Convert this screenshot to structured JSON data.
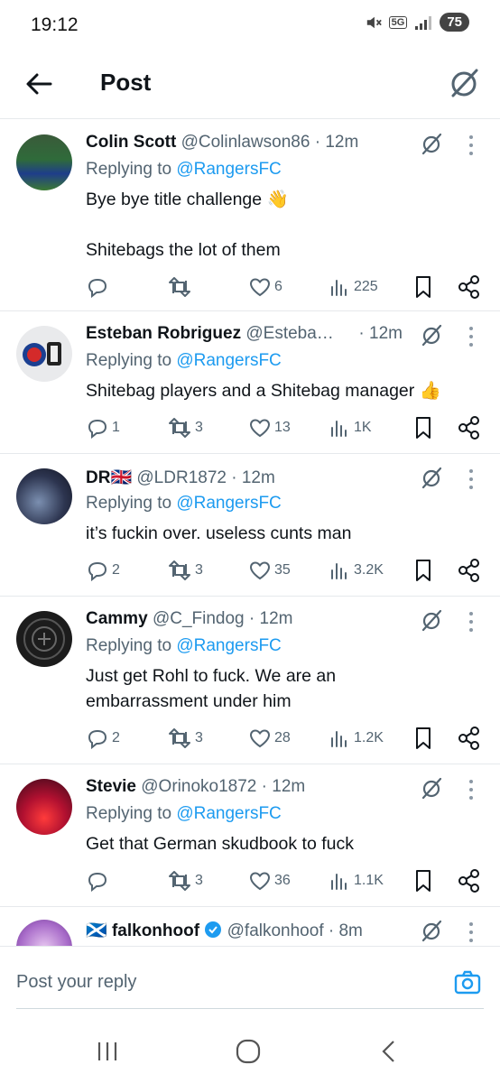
{
  "status": {
    "time": "19:12",
    "network": "5G",
    "battery": "75"
  },
  "header": {
    "title": "Post"
  },
  "posts": [
    {
      "author": "Colin Scott",
      "handle": "@Colinlawson86",
      "time": "· 12m",
      "reply_prefix": "Replying to",
      "reply_to": "@RangersFC",
      "line1": "Bye bye title challenge 👋",
      "line2": "",
      "line3": "Shitebags the lot of them",
      "replies": "",
      "reposts": "",
      "likes": "6",
      "views": "225"
    },
    {
      "author": "Esteban Robriguez",
      "handle": "@Esteba…",
      "time": "· 12m",
      "reply_prefix": "Replying to",
      "reply_to": "@RangersFC",
      "line1": "Shitebag players and a Shitebag manager 👍",
      "replies": "1",
      "reposts": "3",
      "likes": "13",
      "views": "1K"
    },
    {
      "author": "DR🇬🇧",
      "handle": "@LDR1872",
      "time": "· 12m",
      "reply_prefix": "Replying to",
      "reply_to": "@RangersFC",
      "line1": "it’s fuckin over. useless cunts man",
      "replies": "2",
      "reposts": "3",
      "likes": "35",
      "views": "3.2K"
    },
    {
      "author": "Cammy",
      "handle": "@C_Findog",
      "time": "· 12m",
      "reply_prefix": "Replying to",
      "reply_to": "@RangersFC",
      "line1": "Just get Rohl to fuck. We are an",
      "line2": "embarrassment under him",
      "replies": "2",
      "reposts": "3",
      "likes": "28",
      "views": "1.2K"
    },
    {
      "author": "Stevie",
      "handle": "@Orinoko1872",
      "time": "· 12m",
      "reply_prefix": "Replying to",
      "reply_to": "@RangersFC",
      "line1": "Get that German skudbook to fuck",
      "replies": "",
      "reposts": "3",
      "likes": "36",
      "views": "1.1K"
    },
    {
      "author": "falkonhoof",
      "handle": "@falkonhoof",
      "time": "· 8m",
      "flag": "🏴󠁧󠁢󠁳󠁣󠁴󠁿"
    }
  ],
  "reply_bar": {
    "placeholder": "Post your reply"
  },
  "colors": {
    "accent": "#1d9bf0",
    "secondary_text": "#536471",
    "primary_text": "#0f1419"
  }
}
